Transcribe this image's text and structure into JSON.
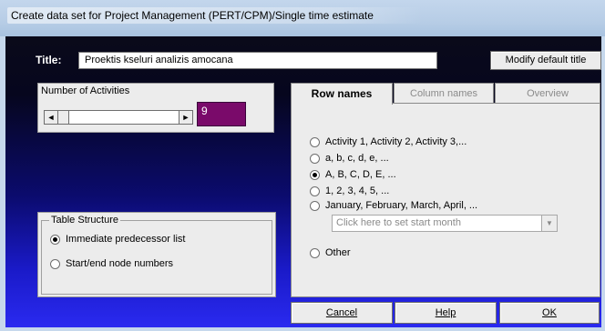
{
  "window": {
    "title": "Create data set for Project Management (PERT/CPM)/Single time estimate"
  },
  "title_row": {
    "label": "Title:",
    "value": "Proektis kseluri analizis amocana",
    "modify_button": "Modify default title"
  },
  "activities": {
    "label": "Number of Activities",
    "value": "9",
    "left_arrow": "◄",
    "right_arrow": "►"
  },
  "table_structure": {
    "legend": "Table Structure",
    "options": [
      {
        "label": "Immediate predecessor list",
        "selected": true
      },
      {
        "label": "Start/end node numbers",
        "selected": false
      }
    ]
  },
  "tabs": [
    {
      "label": "Row names",
      "active": true
    },
    {
      "label": "Column names",
      "active": false
    },
    {
      "label": "Overview",
      "active": false
    }
  ],
  "row_names": {
    "options": [
      {
        "label": "Activity 1, Activity 2, Activity 3,...",
        "selected": false
      },
      {
        "label": "a, b, c, d, e, ...",
        "selected": false
      },
      {
        "label": "A, B, C, D, E, ...",
        "selected": true
      },
      {
        "label": "1, 2, 3, 4, 5, ...",
        "selected": false
      },
      {
        "label": "January, February, March, April, ...",
        "selected": false
      }
    ],
    "month_placeholder": "Click here to set start month",
    "other": "Other"
  },
  "buttons": {
    "cancel": "Cancel",
    "help": "Help",
    "ok": "OK"
  }
}
